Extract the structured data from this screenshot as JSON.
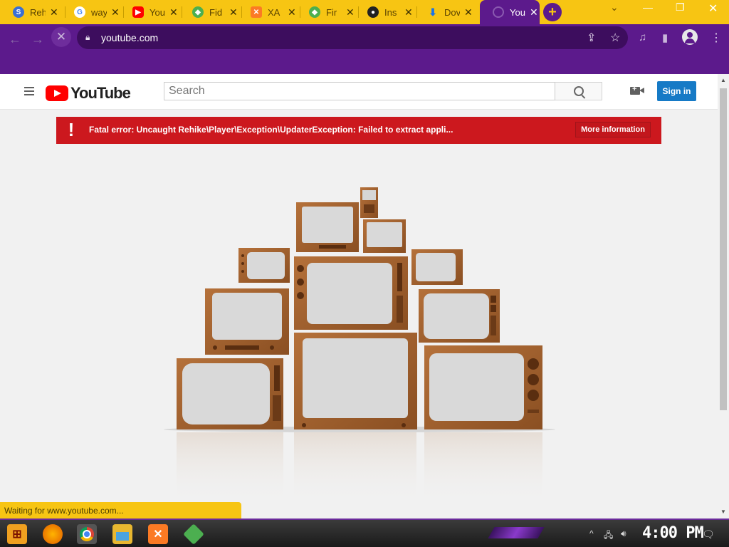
{
  "browser": {
    "tabs": [
      {
        "title": "Reh",
        "icon": "rehike-icon",
        "color": "#3b6fd4"
      },
      {
        "title": "way",
        "icon": "google-icon",
        "color": "#ffffff"
      },
      {
        "title": "You",
        "icon": "youtube-icon",
        "color": "#ff0000"
      },
      {
        "title": "Fid",
        "icon": "fiddler-icon",
        "color": "#4caf50"
      },
      {
        "title": "XA",
        "icon": "xampp-icon",
        "color": "#fb7a24"
      },
      {
        "title": "Fir",
        "icon": "fiddler-icon",
        "color": "#4caf50"
      },
      {
        "title": "Ins",
        "icon": "github-icon",
        "color": "#222222"
      },
      {
        "title": "Dov",
        "icon": "download-icon",
        "color": "#1a73e8"
      },
      {
        "title": "You",
        "icon": "loading-icon",
        "color": "#ffffff"
      }
    ],
    "active_tab_index": 8,
    "url": "youtube.com",
    "status_text": "Waiting for www.youtube.com..."
  },
  "youtube": {
    "logo_text": "YouTube",
    "search_placeholder": "Search",
    "sign_in": "Sign in",
    "error_message": "Fatal error: Uncaught Rehike\\Player\\Exception\\UpdaterException: Failed to extract appli...",
    "more_info": "More information"
  },
  "taskbar": {
    "time": "4:00 PM",
    "apps": [
      "start-icon",
      "firefox-icon",
      "chrome-icon",
      "file-explorer-icon",
      "xampp-icon",
      "fiddler-icon"
    ]
  },
  "colors": {
    "accent": "#5c1a8c",
    "tabstrip": "#f7c513",
    "error": "#cc181e",
    "signin": "#167ac6"
  }
}
